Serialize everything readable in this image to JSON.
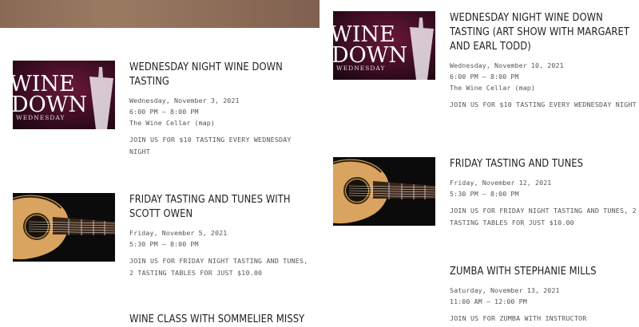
{
  "events_left": [
    {
      "title": "WEDNESDAY NIGHT WINE DOWN TASTING",
      "date": "Wednesday, November 3, 2021",
      "time": "6:00 PM – 8:00 PM",
      "location": "The Wine Cellar (map)",
      "description": "JOIN US FOR $10 TASTING EVERY WEDNESDAY NIGHT",
      "image": "wine-down"
    },
    {
      "title": "FRIDAY TASTING AND TUNES WITH SCOTT OWEN",
      "date": "Friday, November 5, 2021",
      "time": "5:30 PM – 8:00 PM",
      "description": "JOIN US FOR FRIDAY NIGHT TASTING AND TUNES, 2 TASTING TABLES FOR JUST $10.00",
      "image": "guitar"
    },
    {
      "title": "WINE CLASS WITH SOMMELIER MISSY"
    }
  ],
  "events_right": [
    {
      "title": "WEDNESDAY NIGHT WINE DOWN TASTING (ART SHOW WITH MARGARET AND EARL TODD)",
      "date": "Wednesday, November 10, 2021",
      "time": "6:00 PM – 8:00 PM",
      "location": "The Wine Cellar (map)",
      "description": "JOIN US FOR $10 TASTING EVERY WEDNESDAY NIGHT",
      "image": "wine-down"
    },
    {
      "title": "FRIDAY TASTING AND TUNES",
      "date": "Friday, November 12, 2021",
      "time": "5:30 PM – 8:00 PM",
      "description": "JOIN US FOR FRIDAY NIGHT TASTING AND TUNES, 2 TASTING TABLES FOR JUST $10.00",
      "image": "guitar"
    },
    {
      "title": "ZUMBA WITH STEPHANIE MILLS",
      "date": "Saturday, November 13, 2021",
      "time": "11:00 AM – 12:00 PM",
      "description": "JOIN US FOR ZUMBA WITH INSTRUCTOR"
    }
  ],
  "thumbnails": {
    "wine_down": {
      "line1": "WINE",
      "line2": "DOWN",
      "line3": "WEDNESDAY"
    }
  },
  "colors": {
    "title": "#222222",
    "meta": "#555555",
    "wine_bg": "#3a0c22",
    "guitar_wood": "#d9a45f"
  }
}
